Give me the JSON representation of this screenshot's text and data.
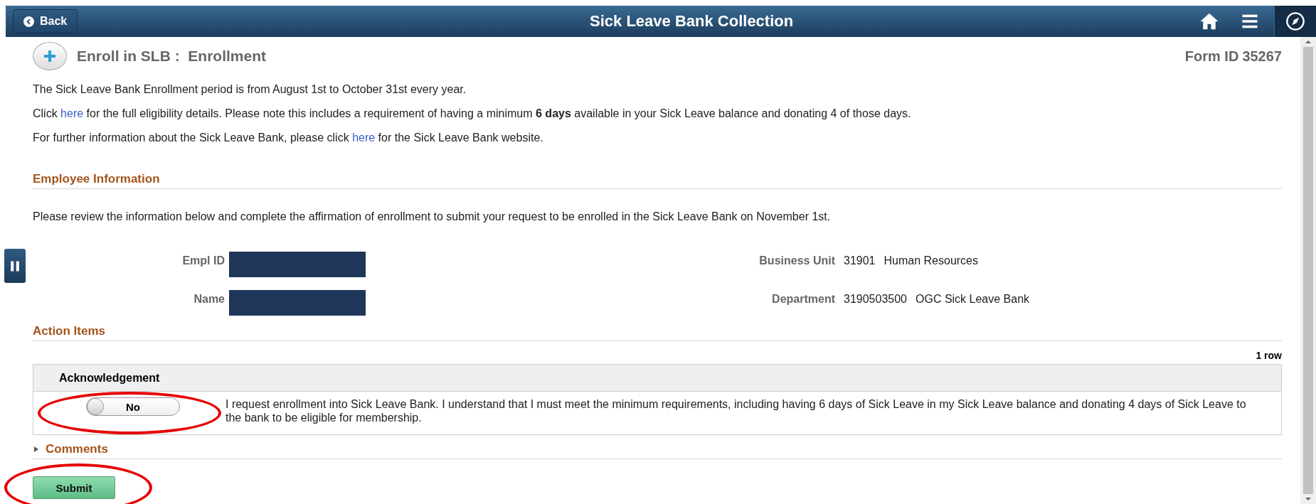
{
  "header": {
    "back_label": "Back",
    "title": "Sick Leave Bank Collection"
  },
  "page": {
    "title": "Enroll in SLB :  Enrollment",
    "form_id_label": "Form ID",
    "form_id": "35267"
  },
  "intro": [
    "The Sick Leave Bank Enrollment period is from August 1st to October 31st every year.",
    {
      "before": "Click ",
      "link": "here",
      "after": " for the full eligibility details. Please note this includes a requirement of having a minimum **6 days** available in your Sick Leave balance and donating 4 of those days."
    },
    {
      "before": "For further information about the Sick Leave Bank, please click ",
      "link": "here",
      "after": " for the Sick Leave Bank website."
    }
  ],
  "employee_information": {
    "heading": "Employee Information",
    "instructions": "Please review the information below and complete the affirmation of enrollment to submit your request to be enrolled in the Sick Leave Bank on November 1st.",
    "left_fields": [
      {
        "label": "Empl ID",
        "redacted": true
      },
      {
        "label": "Name",
        "redacted": true
      }
    ],
    "right_fields": [
      {
        "label": "Business Unit",
        "code": "31901",
        "description": "Human Resources"
      },
      {
        "label": "Department",
        "code": "3190503500",
        "description": "OGC Sick Leave Bank"
      }
    ]
  },
  "action_items": {
    "heading": "Action Items",
    "row_count": "1 row",
    "column": "Acknowledgement",
    "rows": [
      {
        "toggle": {
          "label": "No",
          "on": false,
          "highlighted": true
        },
        "text": "I request enrollment into Sick Leave Bank. I understand that I must meet the minimum requirements, including having 6 days of Sick Leave in my Sick Leave balance and donating 4 days of Sick Leave to the bank to be eligible for membership."
      }
    ]
  },
  "comments": {
    "label": "Comments",
    "expanded": false
  },
  "submit": {
    "label": "Submit",
    "highlighted": true
  }
}
